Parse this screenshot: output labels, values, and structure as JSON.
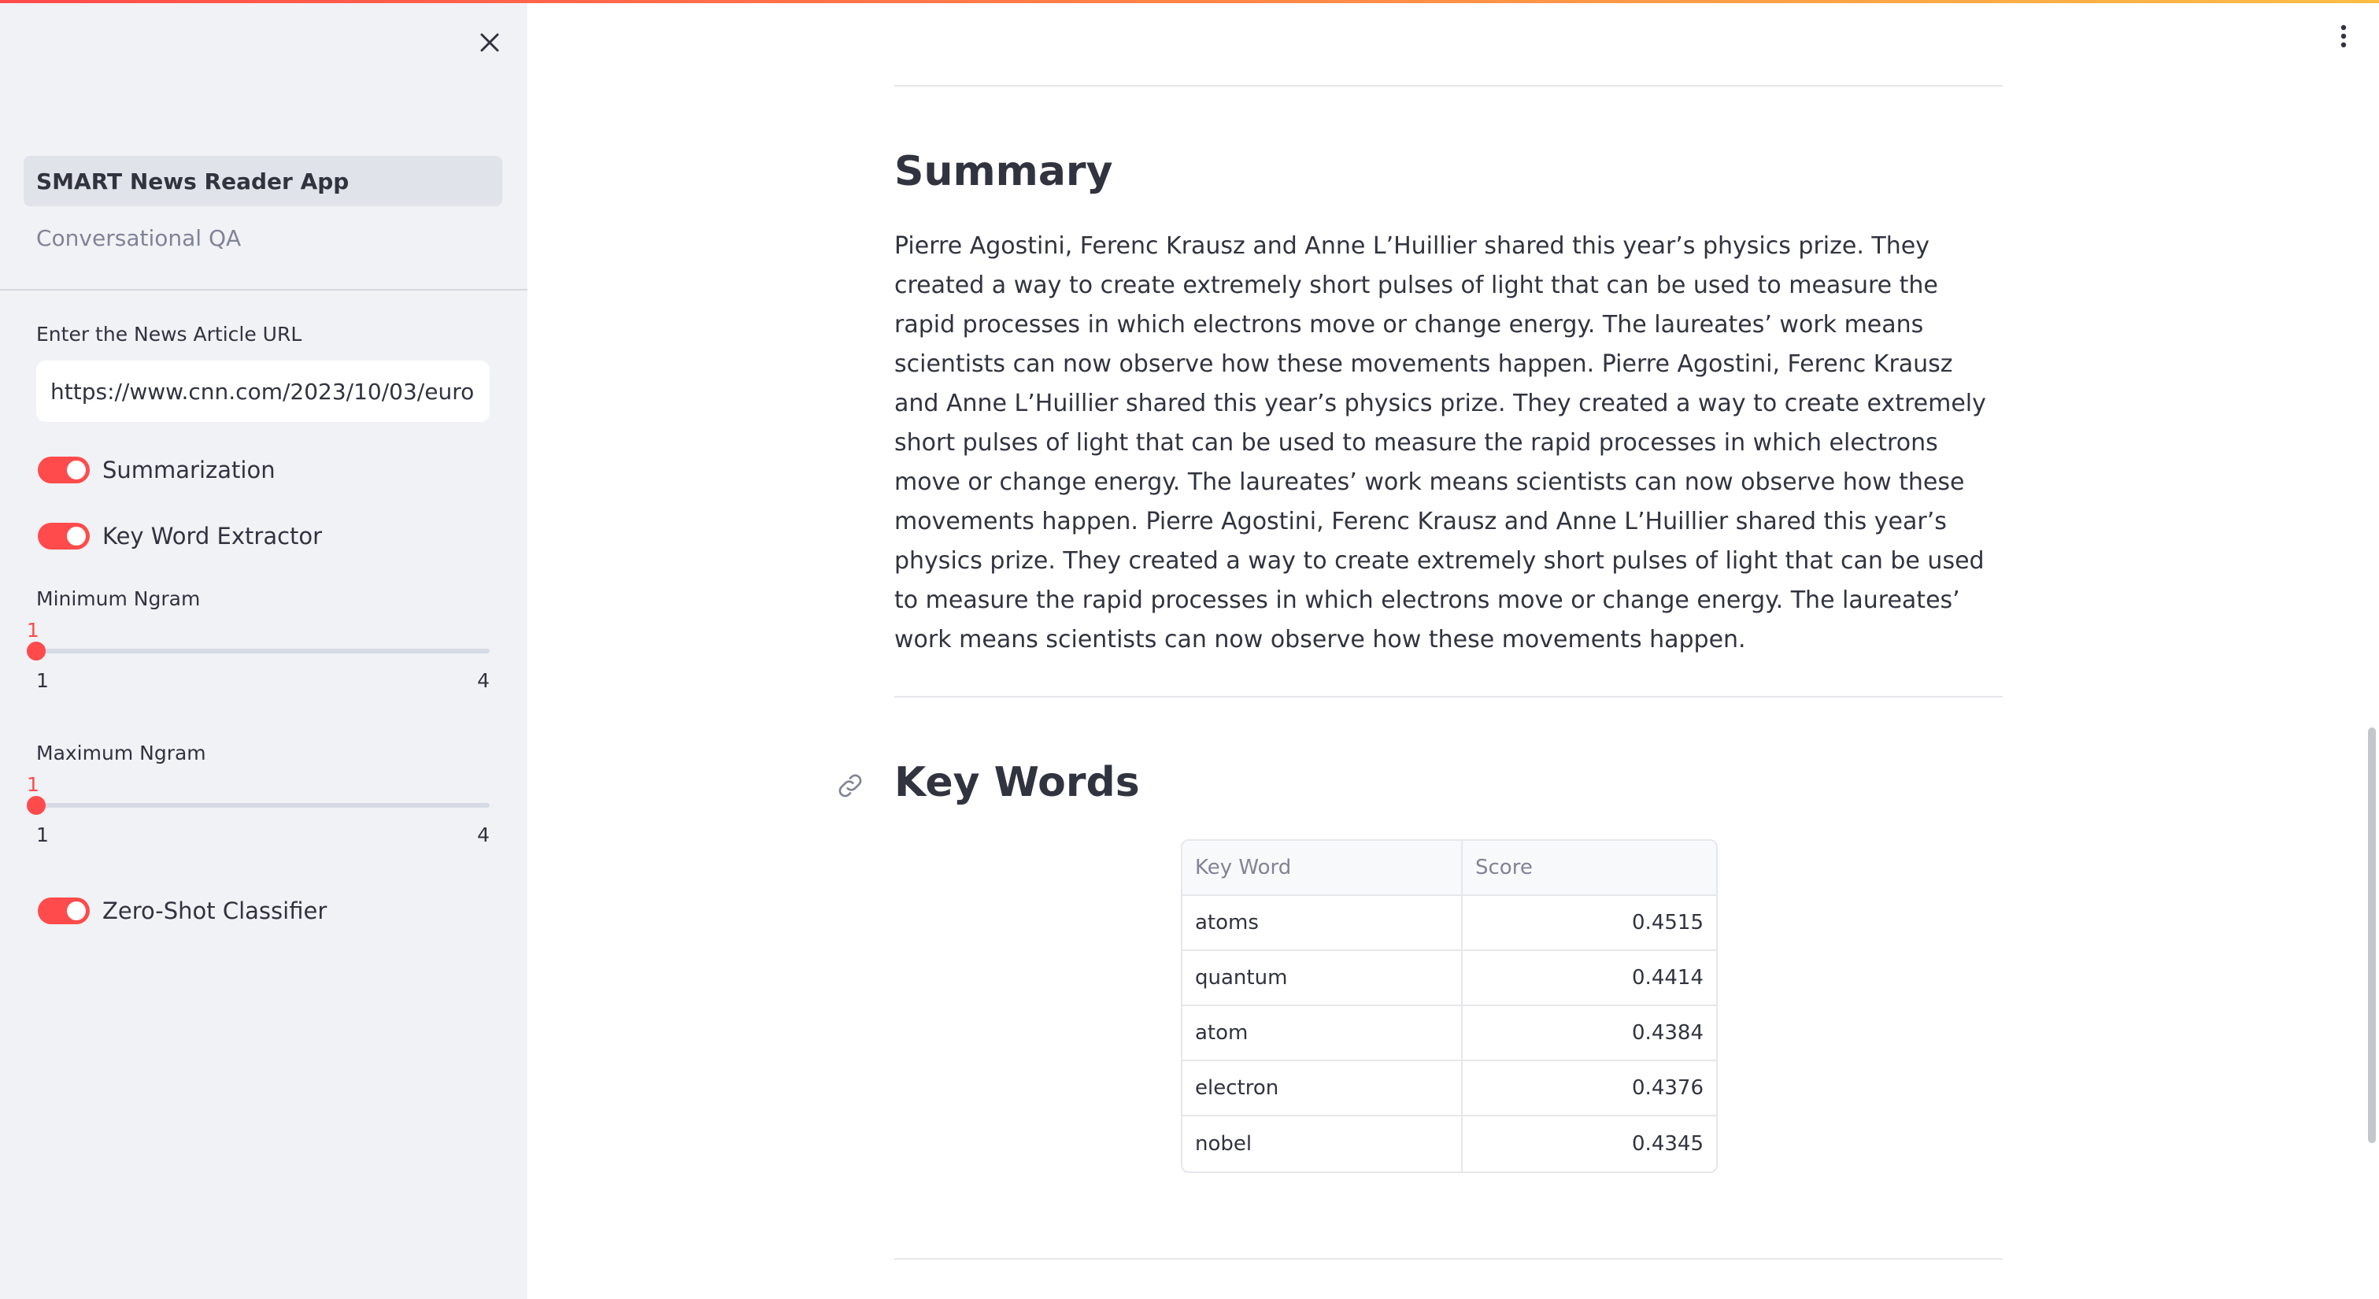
{
  "sidebar": {
    "nav": [
      {
        "label": "SMART News Reader App",
        "active": true
      },
      {
        "label": "Conversational QA",
        "active": false
      }
    ],
    "url_label": "Enter the News Article URL",
    "url_value": "https://www.cnn.com/2023/10/03/europ",
    "summarization_label": "Summarization",
    "summarization_on": true,
    "keyword_label": "Key Word Extractor",
    "keyword_on": true,
    "min_ngram": {
      "label": "Minimum Ngram",
      "value": "1",
      "min": "1",
      "max": "4"
    },
    "max_ngram": {
      "label": "Maximum Ngram",
      "value": "1",
      "min": "1",
      "max": "4"
    },
    "zeroshot_label": "Zero-Shot Classifier",
    "zeroshot_on": true
  },
  "main": {
    "summary_title": "Summary",
    "summary_text": "Pierre Agostini, Ferenc Krausz and Anne L’Huillier shared this year’s physics prize. They created a way to create extremely short pulses of light that can be used to measure the rapid processes in which electrons move or change energy. The laureates’ work means scientists can now observe how these movements happen. Pierre Agostini, Ferenc Krausz and Anne L’Huillier shared this year’s physics prize. They created a way to create extremely short pulses of light that can be used to measure the rapid processes in which electrons move or change energy. The laureates’ work means scientists can now observe how these movements happen. Pierre Agostini, Ferenc Krausz and Anne L’Huillier shared this year’s physics prize. They created a way to create extremely short pulses of light that can be used to measure the rapid processes in which electrons move or change energy. The laureates’ work means scientists can now observe how these movements happen.",
    "keywords_title": "Key Words",
    "table": {
      "headers": [
        "Key Word",
        "Score"
      ],
      "rows": [
        [
          "atoms",
          "0.4515"
        ],
        [
          "quantum",
          "0.4414"
        ],
        [
          "atom",
          "0.4384"
        ],
        [
          "electron",
          "0.4376"
        ],
        [
          "nobel",
          "0.4345"
        ]
      ]
    }
  },
  "colors": {
    "accent": "#ff4b4b",
    "sidebar_bg": "#f0f2f6",
    "text": "#31333f"
  },
  "icons": {
    "close": "close-icon",
    "menu": "kebab-menu-icon",
    "link": "link-icon"
  }
}
